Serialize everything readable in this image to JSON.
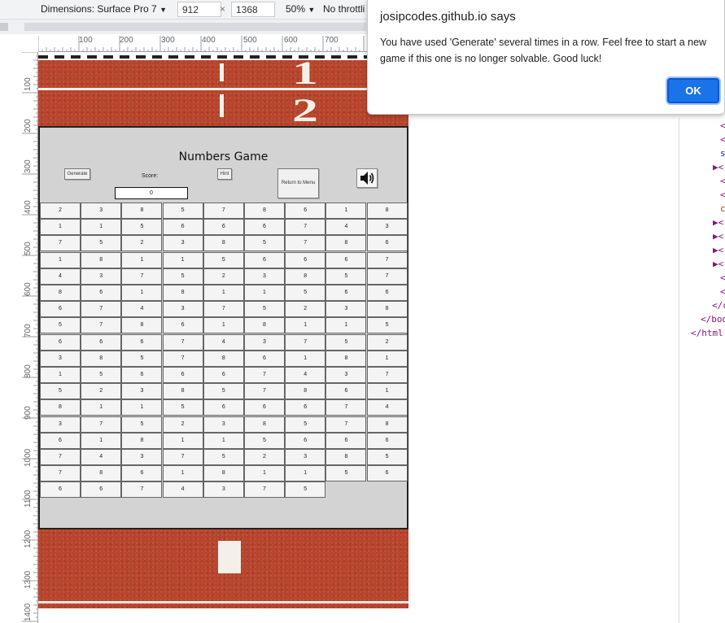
{
  "devtools": {
    "dimensions_label": "Dimensions: Surface Pro 7",
    "width_value": "912",
    "times_sign": "×",
    "height_value": "1368",
    "zoom": "50%",
    "throttling": "No throttli",
    "hruler_ticks": [
      "100",
      "200",
      "300",
      "400",
      "500",
      "600",
      "700"
    ],
    "vruler_ticks": [
      "100",
      "200",
      "300",
      "400",
      "500",
      "600",
      "700",
      "800",
      "900",
      "1000",
      "1100",
      "1200",
      "1300",
      "1400"
    ],
    "tree_lines": [
      {
        "text": "<",
        "color": "#881280"
      },
      {
        "text": "<",
        "color": "#881280"
      },
      {
        "text": "s",
        "color": "#1a1aa6"
      },
      {
        "text": "▶<",
        "color": "#881280"
      },
      {
        "text": "<",
        "color": "#881280"
      },
      {
        "text": "<",
        "color": "#881280"
      },
      {
        "text": "c",
        "color": "#994500"
      },
      {
        "text": "▶<",
        "color": "#881280"
      },
      {
        "text": "▶<",
        "color": "#881280"
      },
      {
        "text": "▶<",
        "color": "#881280"
      },
      {
        "text": "▶<",
        "color": "#881280"
      },
      {
        "text": "<",
        "color": "#881280"
      },
      {
        "text": "<",
        "color": "#881280"
      },
      {
        "text": "</c",
        "color": "#881280"
      },
      {
        "text": "</bod",
        "color": "#881280"
      },
      {
        "text": "</html",
        "color": "#881280"
      }
    ]
  },
  "track": {
    "lane_1": "1",
    "lane_2": "2"
  },
  "game": {
    "title": "Numbers Game",
    "generate_label": "Generate",
    "score_label": "Score:",
    "score_value": "0",
    "hint_label": "Hint",
    "return_label": "Return to Menu",
    "sound_icon": "speaker-icon",
    "rows": [
      [
        "2",
        "3",
        "8",
        "5",
        "7",
        "8",
        "6",
        "1",
        "8"
      ],
      [
        "1",
        "1",
        "5",
        "6",
        "6",
        "6",
        "7",
        "4",
        "3"
      ],
      [
        "7",
        "5",
        "2",
        "3",
        "8",
        "5",
        "7",
        "8",
        "6"
      ],
      [
        "1",
        "8",
        "1",
        "1",
        "5",
        "6",
        "6",
        "6",
        "7"
      ],
      [
        "4",
        "3",
        "7",
        "5",
        "2",
        "3",
        "8",
        "5",
        "7"
      ],
      [
        "8",
        "6",
        "1",
        "8",
        "1",
        "1",
        "5",
        "6",
        "6"
      ],
      [
        "6",
        "7",
        "4",
        "3",
        "7",
        "5",
        "2",
        "3",
        "8"
      ],
      [
        "5",
        "7",
        "8",
        "6",
        "1",
        "8",
        "1",
        "1",
        "5"
      ],
      [
        "6",
        "6",
        "6",
        "7",
        "4",
        "3",
        "7",
        "5",
        "2"
      ],
      [
        "3",
        "8",
        "5",
        "7",
        "8",
        "6",
        "1",
        "8",
        "1"
      ],
      [
        "1",
        "5",
        "6",
        "6",
        "6",
        "7",
        "4",
        "3",
        "7"
      ],
      [
        "5",
        "2",
        "3",
        "8",
        "5",
        "7",
        "8",
        "6",
        "1"
      ],
      [
        "8",
        "1",
        "1",
        "5",
        "6",
        "6",
        "6",
        "7",
        "4"
      ],
      [
        "3",
        "7",
        "5",
        "2",
        "3",
        "8",
        "5",
        "7",
        "8"
      ],
      [
        "6",
        "1",
        "8",
        "1",
        "1",
        "5",
        "6",
        "6",
        "6"
      ],
      [
        "7",
        "4",
        "3",
        "7",
        "5",
        "2",
        "3",
        "8",
        "5"
      ],
      [
        "7",
        "8",
        "6",
        "1",
        "8",
        "1",
        "1",
        "5",
        "6"
      ],
      [
        "6",
        "6",
        "7",
        "4",
        "3",
        "7",
        "5"
      ]
    ]
  },
  "alert": {
    "title": "josipcodes.github.io says",
    "message": "You have used 'Generate' several times in a row. Feel free to start a new game if this one is no longer solvable. Good luck!",
    "ok_label": "OK"
  }
}
